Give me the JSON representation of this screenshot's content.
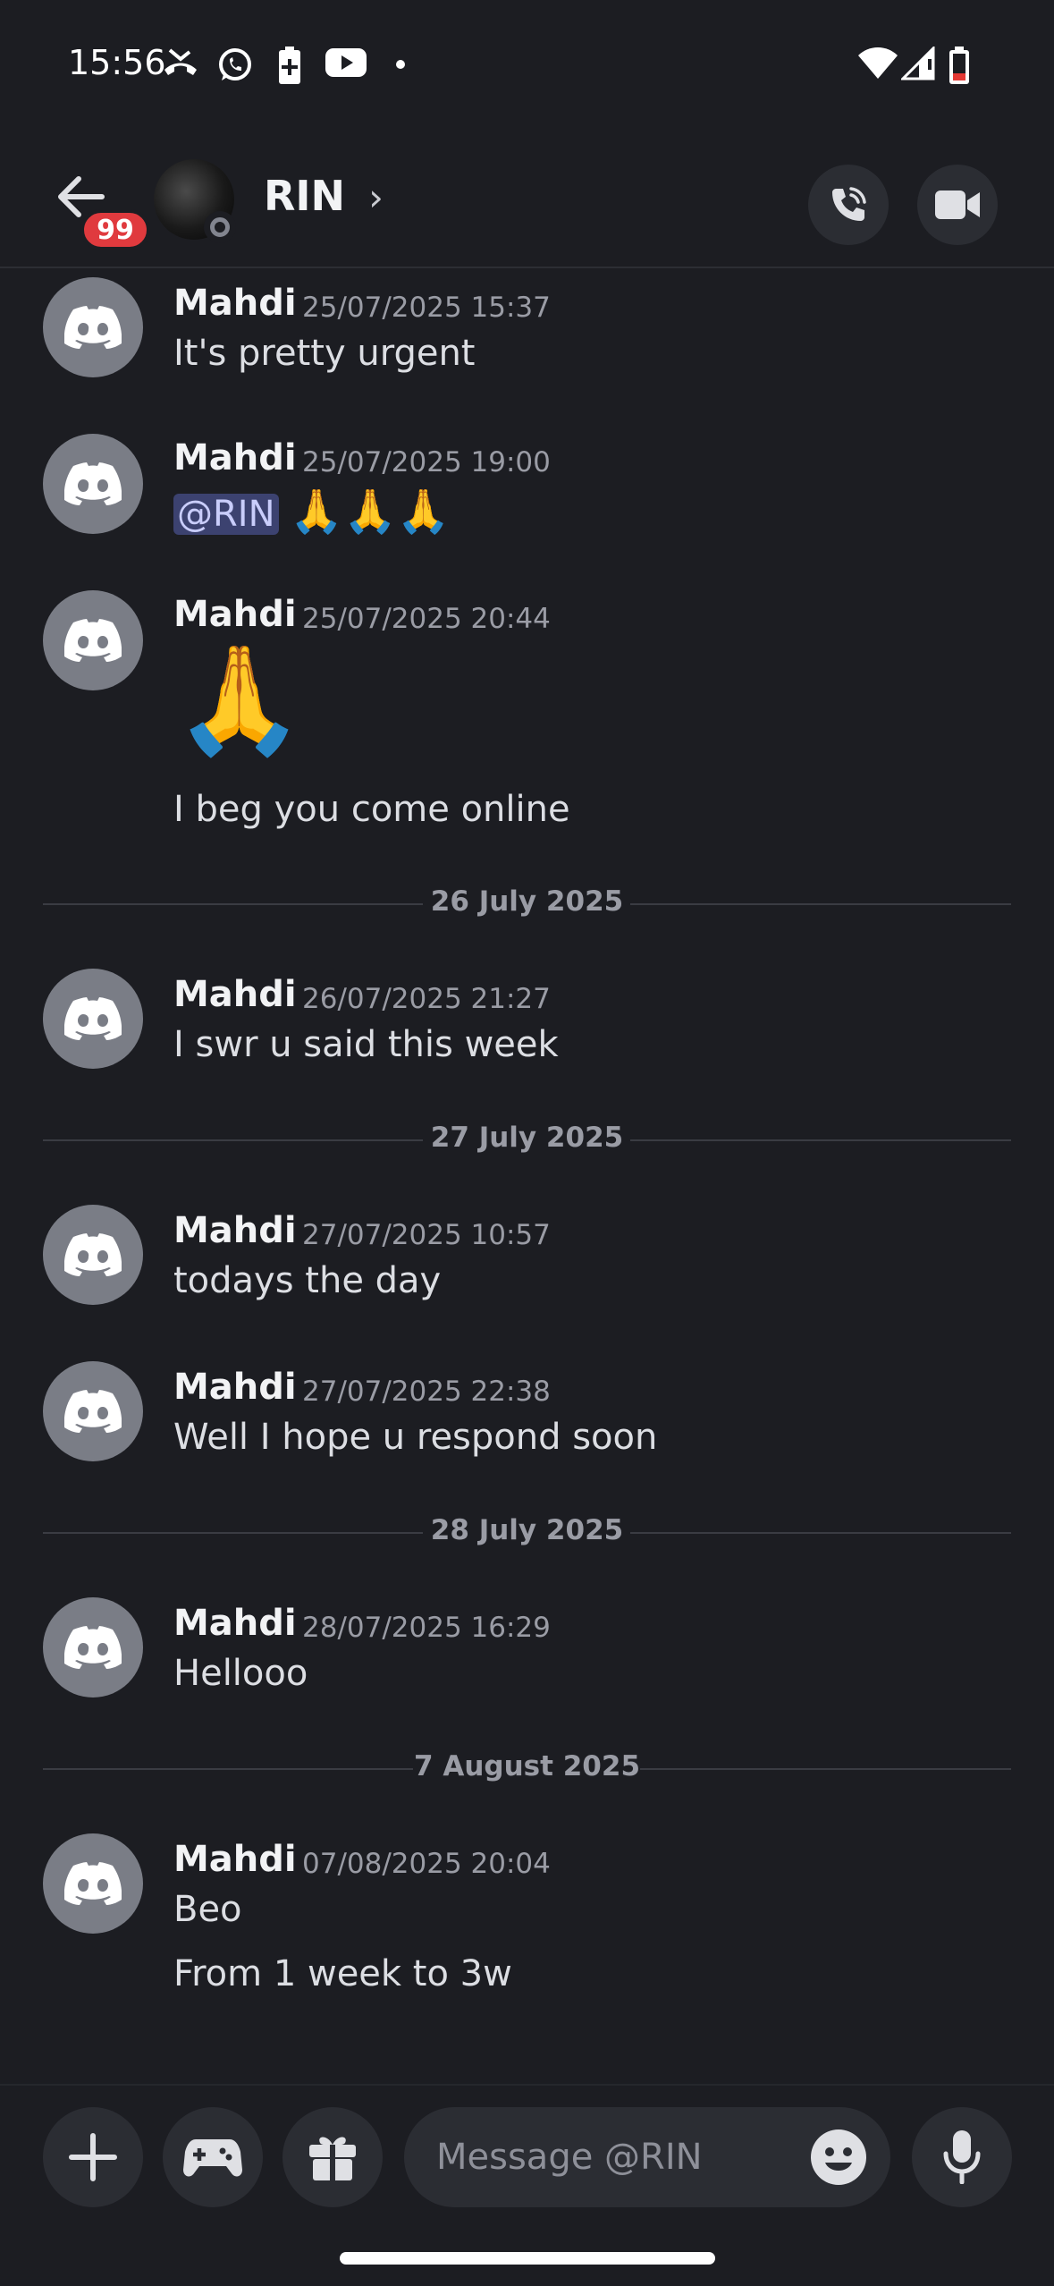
{
  "status_bar": {
    "time": "15:56",
    "icons": [
      "missed-call-icon",
      "whatsapp-icon",
      "battery-saver-icon",
      "youtube-icon",
      "dot-icon",
      "wifi-icon",
      "signal-icon",
      "battery-low-icon"
    ]
  },
  "header": {
    "unread_badge": "99",
    "title": "RIN",
    "chevron": "›",
    "status": "offline"
  },
  "messages": [
    {
      "author": "Mahdi",
      "timestamp": "25/07/2025 15:37",
      "lines": [
        "It's pretty urgent"
      ]
    },
    {
      "author": "Mahdi",
      "timestamp": "25/07/2025 19:00",
      "mention": "@RIN",
      "emoji": "🙏🙏🙏"
    },
    {
      "author": "Mahdi",
      "timestamp": "25/07/2025 20:44",
      "big_emoji": "🙏",
      "lines": [
        "I beg you come online"
      ]
    },
    {
      "author": "Mahdi",
      "timestamp": "26/07/2025 21:27",
      "lines": [
        "I swr u said this week"
      ]
    },
    {
      "author": "Mahdi",
      "timestamp": "27/07/2025 10:57",
      "lines": [
        "todays the day"
      ]
    },
    {
      "author": "Mahdi",
      "timestamp": "27/07/2025 22:38",
      "lines": [
        "Well I hope u respond soon"
      ]
    },
    {
      "author": "Mahdi",
      "timestamp": "28/07/2025 16:29",
      "lines": [
        "Hellooo"
      ]
    },
    {
      "author": "Mahdi",
      "timestamp": "07/08/2025 20:04",
      "lines": [
        "Beo",
        "From 1 week to 3w"
      ]
    }
  ],
  "dividers": [
    "26 July 2025",
    "27 July 2025",
    "28 July 2025",
    "7 August 2025"
  ],
  "composer": {
    "placeholder": "Message @RIN"
  },
  "colors": {
    "background": "#1c1d22",
    "badge": "#e03a3e",
    "mention_bg": "#3c4270",
    "avatar": "#7a7d86"
  }
}
